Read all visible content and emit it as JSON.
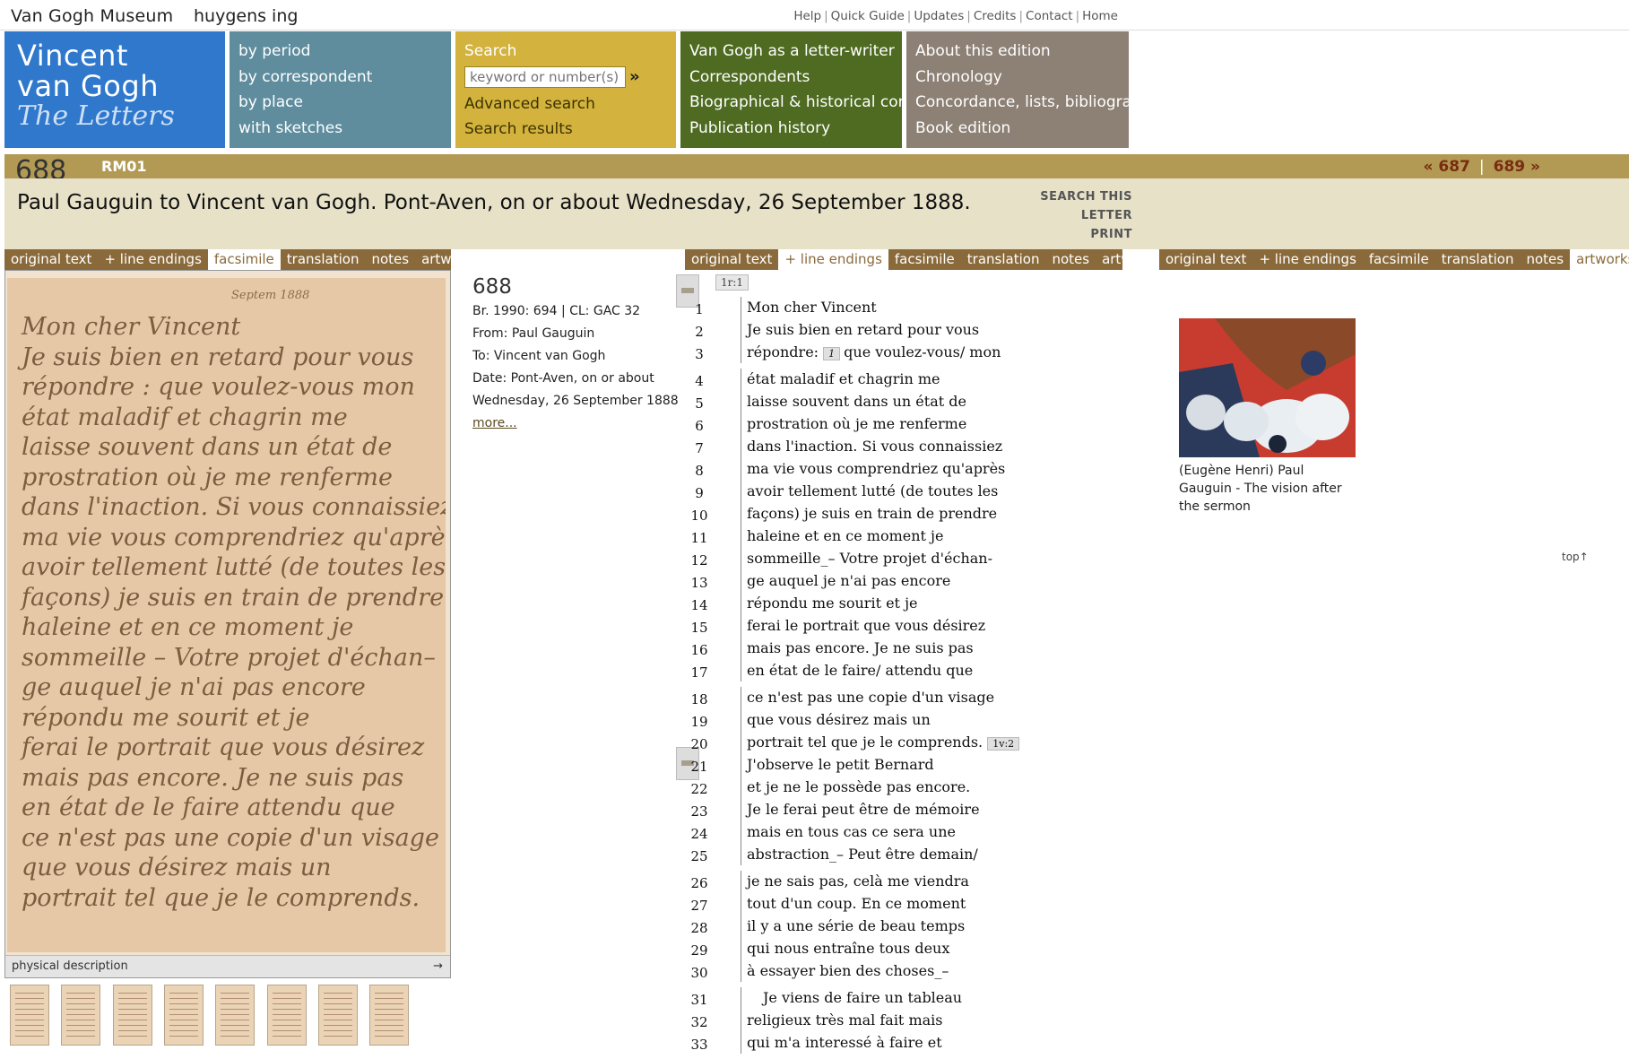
{
  "header": {
    "vgm_logo": "Van Gogh Museum",
    "huygens_logo": "huygens ing",
    "links": [
      "Help",
      "Quick Guide",
      "Updates",
      "Credits",
      "Contact",
      "Home"
    ]
  },
  "nav": {
    "title": {
      "line1": "Vincent",
      "line2": "van Gogh",
      "line3": "The Letters"
    },
    "browse": [
      "by period",
      "by correspondent",
      "by place",
      "with sketches"
    ],
    "search": {
      "label": "Search",
      "placeholder": "keyword or number(s)",
      "go": "»",
      "advanced": "Advanced search",
      "results": "Search results"
    },
    "writer": [
      "Van Gogh as a letter-writer",
      "Correspondents",
      "Biographical & historical context",
      "Publication history"
    ],
    "about": [
      "About this edition",
      "Chronology",
      "Concordance, lists, bibliography",
      "Book edition"
    ]
  },
  "letter": {
    "number": "688",
    "code": "RM01",
    "prev": "« 687",
    "next": "689 »",
    "title": "Paul Gauguin to Vincent van Gogh. Pont-Aven, on or about Wednesday, 26 September 1888.",
    "search_this": "SEARCH THIS LETTER",
    "print": "PRINT"
  },
  "tabs": {
    "left": [
      "original text",
      "+ line endings",
      "facsimile",
      "translation",
      "notes",
      "artworks"
    ],
    "mid": [
      "original text",
      "+ line endings",
      "facsimile",
      "translation",
      "notes",
      "artworks"
    ],
    "right": [
      "original text",
      "+ line endings",
      "facsimile",
      "translation",
      "notes",
      "artworks"
    ]
  },
  "facsimile": {
    "date_note": "Septem 1888",
    "lines": [
      "Mon cher Vincent",
      "Je suis bien en retard pour vous",
      "répondre : que voulez-vous mon",
      "état maladif et chagrin me",
      "laisse souvent dans un état de",
      "prostration où je me renferme",
      "dans l'inaction. Si vous connaissiez",
      "ma vie vous comprendriez qu'après",
      "avoir tellement lutté (de toutes les",
      "façons) je suis en train de prendre",
      "haleine et en ce moment je",
      "sommeille – Votre projet d'échan–",
      "ge auquel je n'ai pas encore",
      "répondu me sourit et je",
      "ferai le portrait que vous désirez",
      "mais pas encore. Je ne suis pas",
      "en état de le faire attendu que",
      "ce n'est pas une copie d'un visage",
      "que vous désirez mais un",
      "portrait tel que je le comprends."
    ],
    "physical_description": "physical description"
  },
  "meta": {
    "number": "688",
    "br": "Br. 1990: 694 | CL: GAC 32",
    "from": "From: Paul Gauguin",
    "to": "To: Vincent van Gogh",
    "date1": "Date: Pont-Aven, on or about",
    "date2": "Wednesday, 26 September 1888",
    "more": "more..."
  },
  "transcription": {
    "page1": "1r:1",
    "page2": "1v:2",
    "note1": "1",
    "lines": [
      "Mon cher Vincent",
      "Je suis bien en retard pour vous",
      "répondre:",
      "état maladif et chagrin me",
      "laisse souvent dans un état de",
      "prostration où je me renferme",
      "dans l'inaction. Si vous connaissiez",
      "ma vie vous comprendriez qu'après",
      "avoir tellement lutté (de toutes les",
      "façons) je suis en train de prendre",
      "haleine et en ce moment je",
      "sommeille_– Votre projet d'échan-",
      "ge auquel je n'ai pas encore",
      "répondu me sourit et je",
      "ferai le portrait que vous désirez",
      "mais pas encore. Je ne suis pas",
      "en état de le faire/ attendu que",
      "ce n'est pas une copie d'un visage",
      "que vous désirez mais un",
      "portrait tel que je le comprends.",
      "J'observe le petit Bernard",
      "et je ne le possède pas encore.",
      "Je le ferai peut être de mémoire",
      "mais en tous cas ce sera une",
      "abstraction_– Peut être demain/",
      "je ne sais pas, celà me viendra",
      "tout d'un coup. En ce moment",
      "il y a une série de beau temps",
      "qui nous entraîne tous deux",
      "à essayer bien des choses_–",
      "Je viens de faire un tableau",
      "religieux très mal fait mais",
      "qui m'a interessé à faire et"
    ],
    "line3_rest": "que voulez-vous/ mon"
  },
  "artwork": {
    "caption": "(Eugène Henri) Paul Gauguin - The vision after the sermon",
    "top": "top"
  }
}
